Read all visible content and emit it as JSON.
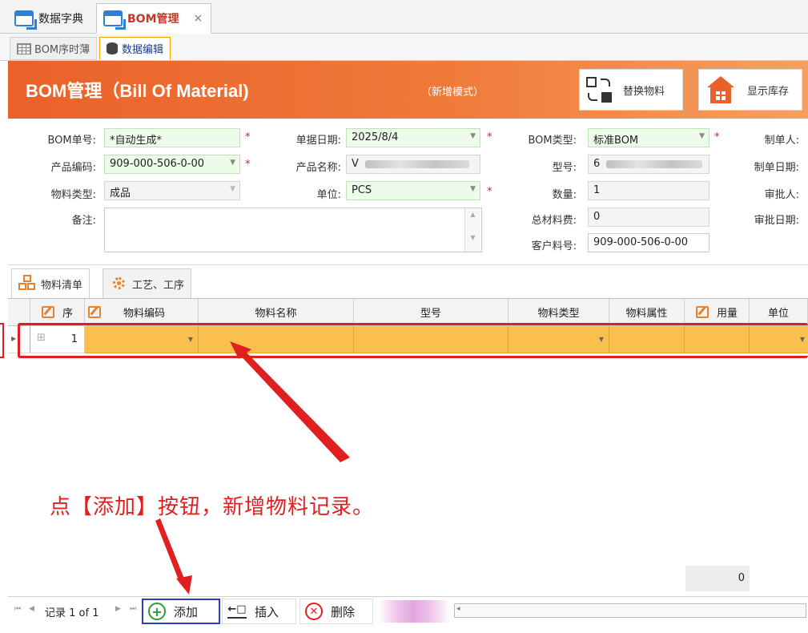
{
  "doc_tabs": [
    {
      "label": "数据字典",
      "active": false
    },
    {
      "label": "BOM管理",
      "active": true,
      "close": "×"
    }
  ],
  "sub_tabs": [
    {
      "label": "BOM序时薄",
      "active": false
    },
    {
      "label": "数据编辑",
      "active": true
    }
  ],
  "header": {
    "title": "BOM管理（Bill Of Material)",
    "mode": "（新增模式）",
    "replace_button": "替换物料",
    "stock_button": "显示库存"
  },
  "form": {
    "bom_no": {
      "label": "BOM单号:",
      "value": "*自动生成*",
      "required": "*"
    },
    "doc_date": {
      "label": "单据日期:",
      "value": "2025/8/4",
      "required": "*"
    },
    "bom_type": {
      "label": "BOM类型:",
      "value": "标准BOM",
      "required": "*"
    },
    "creator": {
      "label": "制单人:"
    },
    "product_code": {
      "label": "产品编码:",
      "value": "909-000-506-0-00",
      "required": "*"
    },
    "product_name": {
      "label": "产品名称:",
      "value": "V"
    },
    "model": {
      "label": "型号:",
      "value": "6"
    },
    "create_date": {
      "label": "制单日期:"
    },
    "material_type": {
      "label": "物料类型:",
      "value": "成品"
    },
    "unit": {
      "label": "单位:",
      "value": "PCS",
      "required": "*"
    },
    "quantity": {
      "label": "数量:",
      "value": "1"
    },
    "approver": {
      "label": "审批人:"
    },
    "remark": {
      "label": "备注:",
      "value": ""
    },
    "total_cost": {
      "label": "总材料费:",
      "value": "0"
    },
    "approve_date": {
      "label": "审批日期:"
    },
    "customer_part_no": {
      "label": "客户料号:",
      "value": "909-000-506-0-00"
    }
  },
  "section_tabs": [
    {
      "label": "物料清单",
      "active": true
    },
    {
      "label": "工艺、工序",
      "active": false
    }
  ],
  "grid": {
    "columns": [
      "序",
      "物料编码",
      "物料名称",
      "型号",
      "物料类型",
      "物料属性",
      "用量",
      "单位"
    ],
    "rows": [
      {
        "seq": "1",
        "expand": "⊞",
        "code": "",
        "name": "",
        "model": "",
        "type": "",
        "attr": "",
        "qty": "",
        "unit": ""
      }
    ],
    "footer_total": "0"
  },
  "nav": {
    "record_text": "记录 1 of 1",
    "add_button": "添加",
    "insert_button": "插入",
    "delete_button": "删除"
  },
  "annotation": "点【添加】按钮，新增物料记录。",
  "colors": {
    "header_orange": "#e9612a",
    "row_highlight": "#fbbf4d",
    "annotation_red": "#e02020",
    "required_green": "#edfbea"
  }
}
